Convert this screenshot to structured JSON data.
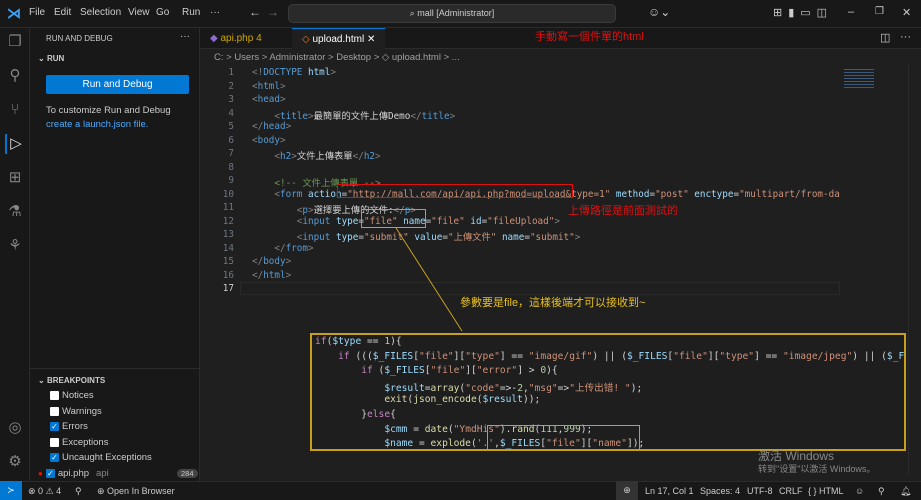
{
  "titlebar": {
    "menu": [
      "File",
      "Edit",
      "Selection",
      "View",
      "Go",
      "Run",
      "···"
    ],
    "search": "mall [Administrator]"
  },
  "sidebar": {
    "title": "RUN AND DEBUG",
    "more": "···",
    "run_section": "RUN",
    "run_button": "Run and Debug",
    "hint": "To customize Run and Debug",
    "link": "create a launch.json file.",
    "breakpoints_title": "BREAKPOINTS",
    "breakpoints": [
      {
        "label": "Notices",
        "checked": false
      },
      {
        "label": "Warnings",
        "checked": false
      },
      {
        "label": "Errors",
        "checked": true
      },
      {
        "label": "Exceptions",
        "checked": false
      },
      {
        "label": "Uncaught Exceptions",
        "checked": true
      },
      {
        "label": "api.php",
        "checked": true,
        "detail": "api",
        "count": "284"
      }
    ]
  },
  "tabs": [
    {
      "label": "api.php",
      "badge": "4",
      "active": false
    },
    {
      "label": "upload.html",
      "active": true
    }
  ],
  "breadcrumb": "C: > Users > Administrator > Desktop > ◇ upload.html > ...",
  "code": [
    [
      [
        "t",
        "<!"
      ],
      [
        "k",
        "DOCTYPE "
      ],
      [
        "a",
        "html"
      ],
      [
        "t",
        ">"
      ]
    ],
    [
      [
        "t",
        "<"
      ],
      [
        "k",
        "html"
      ],
      [
        "t",
        ">"
      ]
    ],
    [
      [
        "t",
        "<"
      ],
      [
        "k",
        "head"
      ],
      [
        "t",
        ">"
      ]
    ],
    [
      [
        "x",
        "    "
      ],
      [
        "t",
        "<"
      ],
      [
        "k",
        "title"
      ],
      [
        "t",
        ">"
      ],
      [
        "x",
        "最簡單的文件上傳Demo"
      ],
      [
        "t",
        "</"
      ],
      [
        "k",
        "title"
      ],
      [
        "t",
        ">"
      ]
    ],
    [
      [
        "t",
        "</"
      ],
      [
        "k",
        "head"
      ],
      [
        "t",
        ">"
      ]
    ],
    [
      [
        "t",
        "<"
      ],
      [
        "k",
        "body"
      ],
      [
        "t",
        ">"
      ]
    ],
    [
      [
        "x",
        "    "
      ],
      [
        "t",
        "<"
      ],
      [
        "k",
        "h2"
      ],
      [
        "t",
        ">"
      ],
      [
        "x",
        "文件上傳表單"
      ],
      [
        "t",
        "</"
      ],
      [
        "k",
        "h2"
      ],
      [
        "t",
        ">"
      ]
    ],
    [],
    [
      [
        "x",
        "    "
      ],
      [
        "c",
        "<!-- 文件上傳表單 -->"
      ]
    ],
    [
      [
        "x",
        "    "
      ],
      [
        "t",
        "<"
      ],
      [
        "k",
        "form "
      ],
      [
        "a",
        "action"
      ],
      [
        "x",
        "="
      ],
      [
        "s",
        "\"http://mall.com/api/api.php?mod=upload&type=1\" "
      ],
      [
        "a",
        "method"
      ],
      [
        "x",
        "="
      ],
      [
        "s",
        "\"post\" "
      ],
      [
        "a",
        "enctype"
      ],
      [
        "x",
        "="
      ],
      [
        "s",
        "\"multipart/from-data\""
      ]
    ],
    [
      [
        "x",
        "        "
      ],
      [
        "t",
        "<"
      ],
      [
        "k",
        "p"
      ],
      [
        "t",
        ">"
      ],
      [
        "x",
        "選擇要上傳的文件:"
      ],
      [
        "t",
        "</"
      ],
      [
        "k",
        "p"
      ],
      [
        "t",
        ">"
      ]
    ],
    [
      [
        "x",
        "        "
      ],
      [
        "t",
        "<"
      ],
      [
        "k",
        "input "
      ],
      [
        "a",
        "type"
      ],
      [
        "x",
        "="
      ],
      [
        "s",
        "\"file\" "
      ],
      [
        "a",
        "name"
      ],
      [
        "x",
        "="
      ],
      [
        "s",
        "\"file\" "
      ],
      [
        "a",
        "id"
      ],
      [
        "x",
        "="
      ],
      [
        "s",
        "\"fileUpload\""
      ],
      [
        "t",
        ">"
      ]
    ],
    [
      [
        "x",
        "        "
      ],
      [
        "t",
        "<"
      ],
      [
        "k",
        "input "
      ],
      [
        "a",
        "type"
      ],
      [
        "x",
        "="
      ],
      [
        "s",
        "\"submit\" "
      ],
      [
        "a",
        "value"
      ],
      [
        "x",
        "="
      ],
      [
        "s",
        "\"上傳文件\" "
      ],
      [
        "a",
        "name"
      ],
      [
        "x",
        "="
      ],
      [
        "s",
        "\"submit\""
      ],
      [
        "t",
        ">"
      ]
    ],
    [
      [
        "x",
        "    "
      ],
      [
        "t",
        "</"
      ],
      [
        "k",
        "from"
      ],
      [
        "t",
        ">"
      ]
    ],
    [
      [
        "t",
        "</"
      ],
      [
        "k",
        "body"
      ],
      [
        "t",
        ">"
      ]
    ],
    [
      [
        "t",
        "</"
      ],
      [
        "k",
        "html"
      ],
      [
        "t",
        ">"
      ]
    ],
    []
  ],
  "php": [
    [
      [
        "kw",
        "if"
      ],
      [
        "p",
        "("
      ],
      [
        "v",
        "$type"
      ],
      [
        "p",
        " == "
      ],
      [
        "n",
        "1"
      ],
      [
        "p",
        "){"
      ]
    ],
    [
      [
        "p",
        "    "
      ],
      [
        "kw",
        "if"
      ],
      [
        "p",
        " ((("
      ],
      [
        "v",
        "$_FILES"
      ],
      [
        "p",
        "["
      ],
      [
        "str",
        "\"file\""
      ],
      [
        "p",
        "]["
      ],
      [
        "str",
        "\"type\""
      ],
      [
        "p",
        "] == "
      ],
      [
        "str",
        "\"image/gif\""
      ],
      [
        "p",
        ") || ("
      ],
      [
        "v",
        "$_FILES"
      ],
      [
        "p",
        "["
      ],
      [
        "str",
        "\"file\""
      ],
      [
        "p",
        "]["
      ],
      [
        "str",
        "\"type\""
      ],
      [
        "p",
        "] == "
      ],
      [
        "str",
        "\"image/jpeg\""
      ],
      [
        "p",
        ") || ("
      ],
      [
        "v",
        "$_FI"
      ]
    ],
    [
      [
        "p",
        "        "
      ],
      [
        "kw",
        "if"
      ],
      [
        "p",
        " ("
      ],
      [
        "v",
        "$_FILES"
      ],
      [
        "p",
        "["
      ],
      [
        "str",
        "\"file\""
      ],
      [
        "p",
        "]["
      ],
      [
        "str",
        "\"error\""
      ],
      [
        "p",
        "] > "
      ],
      [
        "n",
        "0"
      ],
      [
        "p",
        "){"
      ]
    ],
    [
      [
        "p",
        "            "
      ],
      [
        "v",
        "$result"
      ],
      [
        "p",
        "="
      ],
      [
        "f",
        "array"
      ],
      [
        "p",
        "("
      ],
      [
        "str",
        "\"code\""
      ],
      [
        "p",
        "=>-"
      ],
      [
        "n",
        "2"
      ],
      [
        "p",
        ","
      ],
      [
        "str",
        "\"msg\""
      ],
      [
        "p",
        "=>"
      ],
      [
        "str",
        "\"上传出错! \""
      ],
      [
        "p",
        ");"
      ]
    ],
    [
      [
        "p",
        "            "
      ],
      [
        "f",
        "exit"
      ],
      [
        "p",
        "("
      ],
      [
        "f",
        "json_encode"
      ],
      [
        "p",
        "("
      ],
      [
        "v",
        "$result"
      ],
      [
        "p",
        "));"
      ]
    ],
    [
      [
        "p",
        "        "
      ],
      [
        "p",
        "}"
      ],
      [
        "kw",
        "else"
      ],
      [
        "p",
        "{"
      ]
    ],
    [
      [
        "p",
        "            "
      ],
      [
        "v",
        "$cmm"
      ],
      [
        "p",
        " = "
      ],
      [
        "f",
        "date"
      ],
      [
        "p",
        "("
      ],
      [
        "str",
        "\"YmdHis\""
      ],
      [
        "p",
        ")."
      ],
      [
        "f",
        "rand"
      ],
      [
        "p",
        "("
      ],
      [
        "n",
        "111"
      ],
      [
        "p",
        ","
      ],
      [
        "n",
        "999"
      ],
      [
        "p",
        ");"
      ]
    ],
    [
      [
        "p",
        "            "
      ],
      [
        "v",
        "$name"
      ],
      [
        "p",
        " = "
      ],
      [
        "f",
        "explode"
      ],
      [
        "p",
        "("
      ],
      [
        "str",
        "'.'"
      ],
      [
        "p",
        ","
      ],
      [
        "v",
        "$_FILES"
      ],
      [
        "p",
        "["
      ],
      [
        "str",
        "\"file\""
      ],
      [
        "p",
        "]["
      ],
      [
        "str",
        "\"name\""
      ],
      [
        "p",
        "]);"
      ]
    ]
  ],
  "annotations": {
    "top": "手動寫一個件單的html",
    "url": "上傳路徑是前面測試的",
    "param": "參數要是file，這樣後端才可以接收到~"
  },
  "watermark": {
    "line1": "激活 Windows",
    "line2": "转到\"设置\"以激活 Windows。"
  },
  "status": {
    "errors": "0",
    "warnings": "4",
    "open_browser": "Open In Browser",
    "position": "Ln 17, Col 1",
    "spaces": "Spaces: 4",
    "encoding": "UTF-8",
    "eol": "CRLF",
    "language": "{ } HTML"
  },
  "colors": {
    "accent": "#0078d4",
    "annotation_red": "#e01010",
    "annotation_yellow": "#e8c020"
  }
}
